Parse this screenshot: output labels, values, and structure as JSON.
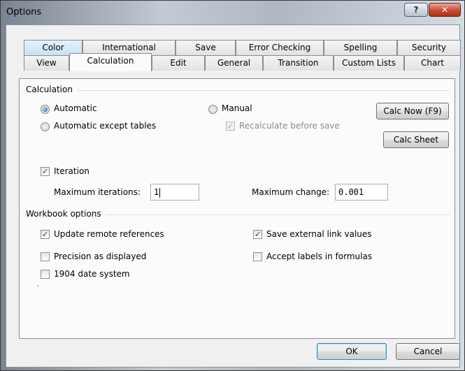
{
  "window": {
    "title": "Options",
    "help_glyph": "?",
    "close_glyph": "✕"
  },
  "tabs": {
    "row1": [
      "Color",
      "International",
      "Save",
      "Error Checking",
      "Spelling",
      "Security"
    ],
    "row2": [
      "View",
      "Calculation",
      "Edit",
      "General",
      "Transition",
      "Custom Lists",
      "Chart"
    ],
    "active": "Calculation"
  },
  "calculation": {
    "group_title": "Calculation",
    "automatic": "Automatic",
    "automatic_except_tables": "Automatic except tables",
    "manual": "Manual",
    "recalc_before_save": "Recalculate before save",
    "selected": "Automatic",
    "calc_now": "Calc Now (F9)",
    "calc_sheet": "Calc Sheet"
  },
  "iteration": {
    "label": "Iteration",
    "checked": true,
    "max_iterations_label": "Maximum iterations:",
    "max_iterations_value": "1",
    "max_change_label": "Maximum change:",
    "max_change_value": "0.001"
  },
  "workbook": {
    "group_title": "Workbook options",
    "update_remote": "Update remote references",
    "precision": "Precision as displayed",
    "date_1904": "1904 date system",
    "save_external": "Save external link values",
    "accept_labels": "Accept labels in formulas"
  },
  "footer": {
    "ok": "OK",
    "cancel": "Cancel"
  }
}
